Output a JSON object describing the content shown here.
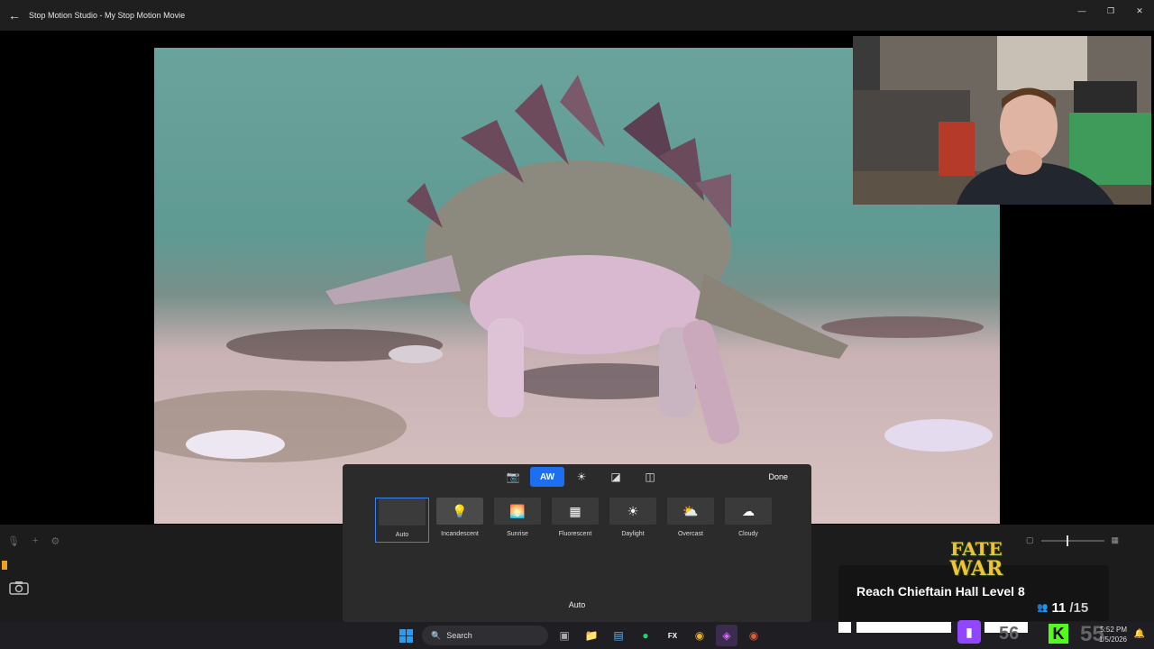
{
  "window": {
    "title": "Stop Motion Studio - My Stop Motion Movie",
    "back_icon": "back-arrow-icon",
    "controls": [
      "—",
      "❐",
      "✕"
    ],
    "extra_controls": [
      "⊘",
      "?"
    ]
  },
  "editor": {
    "tabs": [
      {
        "icon": "camera-icon",
        "glyph": "📷",
        "active": false
      },
      {
        "icon": "white-balance-icon",
        "glyph": "AW",
        "active": true
      },
      {
        "icon": "brightness-icon",
        "glyph": "☀",
        "active": false
      },
      {
        "icon": "exposure-icon",
        "glyph": "◪",
        "active": false
      },
      {
        "icon": "mirror-icon",
        "glyph": "◫",
        "active": false
      }
    ],
    "done_label": "Done",
    "presets": [
      {
        "label": "Auto",
        "glyph": "",
        "icon": "auto-preset",
        "selected": true
      },
      {
        "label": "Incandescent",
        "glyph": "💡",
        "icon": "incandescent-icon",
        "selected": false
      },
      {
        "label": "Sunrise",
        "glyph": "🌅",
        "icon": "sunrise-icon",
        "selected": false
      },
      {
        "label": "Fluorescent",
        "glyph": "▦",
        "icon": "fluorescent-icon",
        "selected": false
      },
      {
        "label": "Daylight",
        "glyph": "☀",
        "icon": "daylight-icon",
        "selected": false
      },
      {
        "label": "Overcast",
        "glyph": "⛅",
        "icon": "overcast-icon",
        "selected": false
      },
      {
        "label": "Cloudy",
        "glyph": "☁",
        "icon": "cloudy-icon",
        "selected": false
      }
    ],
    "current_mode": "Auto"
  },
  "timeline": {
    "icons": [
      "microphone-icon",
      "add-icon",
      "settings-icon"
    ],
    "glyphs": [
      "🎙",
      "+",
      "⚙"
    ],
    "capture_icon": "camera-icon"
  },
  "stream_overlay": {
    "logo_line1": "FATE",
    "logo_line2": "WAR",
    "goal_text": "Reach Chieftain Hall Level 8",
    "goal_current": "11",
    "goal_total": "/15",
    "kick_count": "55",
    "twitch_count": "56"
  },
  "taskbar": {
    "search_placeholder": "Search",
    "time": "5:52 PM",
    "date": "1/5/2026"
  }
}
